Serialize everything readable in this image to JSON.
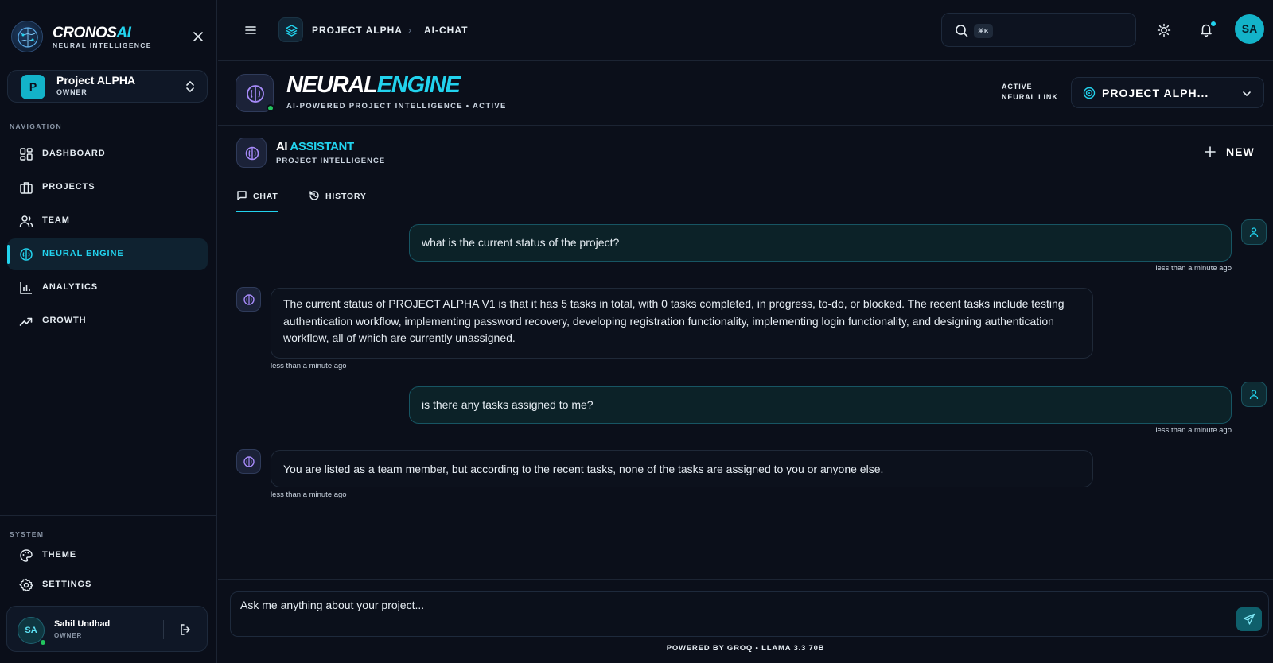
{
  "brand": {
    "name_main": "CRONOS",
    "name_accent": "AI",
    "subtitle": "NEURAL INTELLIGENCE"
  },
  "project_switcher": {
    "initial": "P",
    "name": "Project ALPHA",
    "role": "OWNER"
  },
  "sidebar": {
    "nav_label": "NAVIGATION",
    "items": [
      {
        "label": "DASHBOARD",
        "icon": "dashboard-icon"
      },
      {
        "label": "PROJECTS",
        "icon": "briefcase-icon"
      },
      {
        "label": "TEAM",
        "icon": "users-icon"
      },
      {
        "label": "NEURAL ENGINE",
        "icon": "brain-icon",
        "active": true
      },
      {
        "label": "ANALYTICS",
        "icon": "bar-chart-icon"
      },
      {
        "label": "GROWTH",
        "icon": "trending-up-icon"
      }
    ],
    "system_label": "SYSTEM",
    "system_items": [
      {
        "label": "THEME",
        "icon": "palette-icon"
      },
      {
        "label": "SETTINGS",
        "icon": "gear-icon"
      }
    ],
    "user": {
      "initials": "SA",
      "name": "Sahil Undhad",
      "role": "OWNER"
    }
  },
  "topbar": {
    "breadcrumb": [
      "PROJECT ALPHA",
      "AI-CHAT"
    ],
    "breadcrumb_separator": "›",
    "search_shortcut": "⌘K",
    "search_placeholder": "",
    "avatar_initials": "SA"
  },
  "engine": {
    "title_main": "NEURAL",
    "title_accent": "ENGINE",
    "subtitle": "AI-POWERED PROJECT INTELLIGENCE • ACTIVE",
    "active_link_line1": "ACTIVE",
    "active_link_line2": "NEURAL LINK",
    "project_select_value": "PROJECT ALPH..."
  },
  "assistant": {
    "title_main": "AI",
    "title_accent": "ASSISTANT",
    "subtitle": "PROJECT INTELLIGENCE",
    "new_label": "NEW"
  },
  "tabs": [
    {
      "label": "CHAT",
      "icon": "chat-icon",
      "active": true
    },
    {
      "label": "HISTORY",
      "icon": "history-icon"
    }
  ],
  "messages": [
    {
      "role": "user",
      "text": "what is the current status of the project?",
      "time": "less than a minute ago"
    },
    {
      "role": "ai",
      "text": "The current status of PROJECT ALPHA V1 is that it has 5 tasks in total, with 0 tasks completed, in progress, to-do, or blocked. The recent tasks include testing authentication workflow, implementing password recovery, developing registration functionality, implementing login functionality, and designing authentication workflow, all of which are currently unassigned.",
      "time": "less than a minute ago"
    },
    {
      "role": "user",
      "text": "is there any tasks assigned to me?",
      "time": "less than a minute ago"
    },
    {
      "role": "ai",
      "text": "You are listed as a team member, but according to the recent tasks, none of the tasks are assigned to you or anyone else.",
      "time": "less than a minute ago"
    }
  ],
  "composer": {
    "placeholder": "Ask me anything about your project...",
    "footer": "POWERED BY GROQ • LLAMA 3.3 70B"
  },
  "colors": {
    "background": "#0b0f1a",
    "accent": "#22d3ee",
    "online": "#22c55e",
    "user_bubble": "#0c2228"
  }
}
